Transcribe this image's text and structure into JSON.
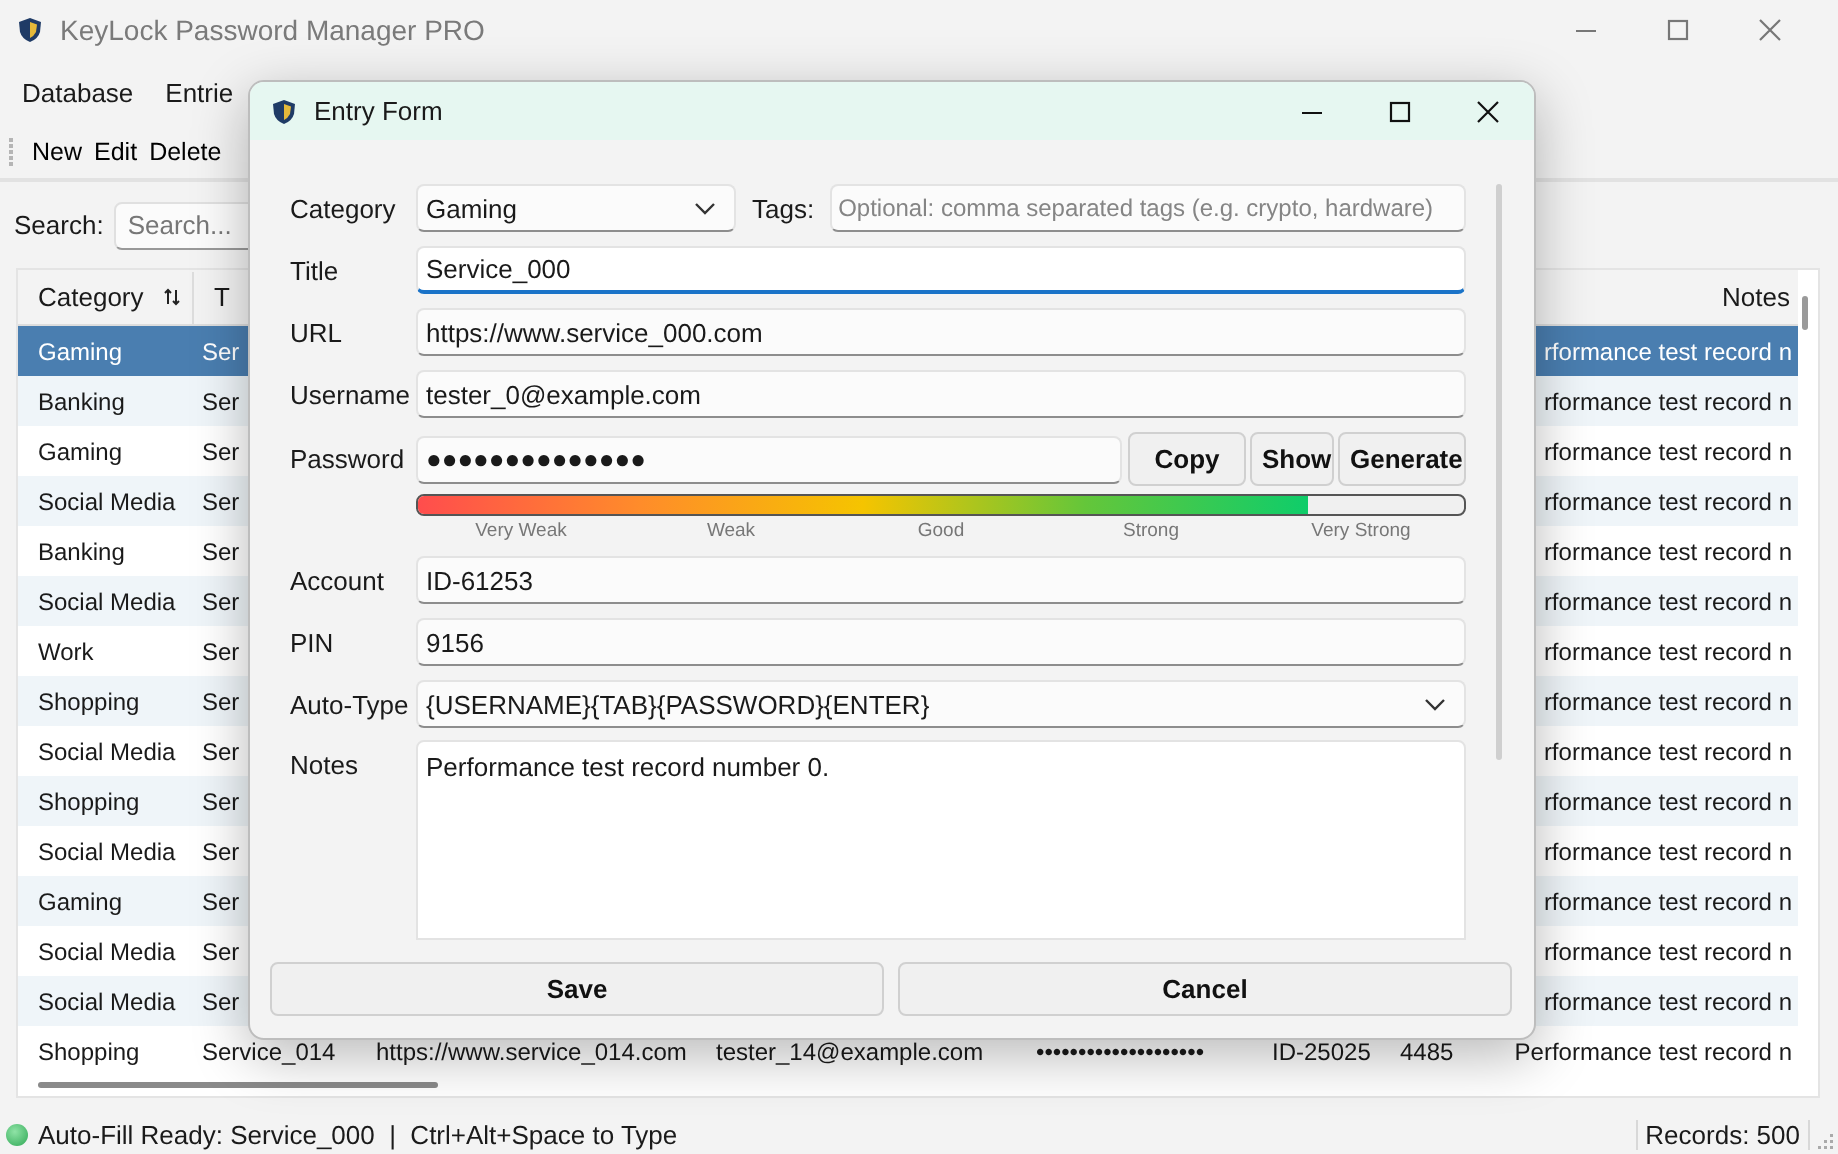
{
  "window": {
    "title": "KeyLock Password Manager PRO"
  },
  "menu": [
    "Database",
    "Entrie"
  ],
  "toolbar": [
    "New",
    "Edit",
    "Delete"
  ],
  "search": {
    "label": "Search:",
    "placeholder": "Search..."
  },
  "table": {
    "columns": [
      {
        "label": "Category",
        "sortable": true
      },
      {
        "label": "T",
        "sortable": false
      },
      {
        "label": "Notes",
        "sortable": false
      }
    ],
    "rows": [
      {
        "category": "Gaming",
        "title": "Ser",
        "notes": "rformance test record n",
        "selected": true
      },
      {
        "category": "Banking",
        "title": "Ser",
        "notes": "rformance test record n",
        "selected": false
      },
      {
        "category": "Gaming",
        "title": "Ser",
        "notes": "rformance test record n",
        "selected": false
      },
      {
        "category": "Social Media",
        "title": "Ser",
        "notes": "rformance test record n",
        "selected": false
      },
      {
        "category": "Banking",
        "title": "Ser",
        "notes": "rformance test record n",
        "selected": false
      },
      {
        "category": "Social Media",
        "title": "Ser",
        "notes": "rformance test record n",
        "selected": false
      },
      {
        "category": "Work",
        "title": "Ser",
        "notes": "rformance test record n",
        "selected": false
      },
      {
        "category": "Shopping",
        "title": "Ser",
        "notes": "rformance test record n",
        "selected": false
      },
      {
        "category": "Social Media",
        "title": "Ser",
        "notes": "rformance test record n",
        "selected": false
      },
      {
        "category": "Shopping",
        "title": "Ser",
        "notes": "rformance test record n",
        "selected": false
      },
      {
        "category": "Social Media",
        "title": "Ser",
        "notes": "rformance test record n",
        "selected": false
      },
      {
        "category": "Gaming",
        "title": "Ser",
        "notes": "rformance test record n",
        "selected": false
      },
      {
        "category": "Social Media",
        "title": "Ser",
        "notes": "rformance test record n",
        "selected": false
      },
      {
        "category": "Social Media",
        "title": "Ser",
        "notes": "rformance test record n",
        "selected": false
      },
      {
        "category": "Shopping",
        "title": "Service_014",
        "url": "https://www.service_014.com",
        "username": "tester_14@example.com",
        "password": "••••••••••••••••••••",
        "account": "ID-25025",
        "pin": "4485",
        "notes": "Performance test record n",
        "selected": false
      }
    ]
  },
  "status_bar": {
    "message": "Auto-Fill Ready: Service_000  |  Ctrl+Alt+Space to Type",
    "records": "Records: 500"
  },
  "dialog": {
    "title": "Entry Form",
    "category": {
      "label": "Category",
      "value": "Gaming"
    },
    "tags": {
      "label": "Tags:",
      "placeholder": "Optional: comma separated tags (e.g. crypto, hardware)"
    },
    "fields": [
      {
        "label": "Title",
        "value": "Service_000",
        "focused": true
      },
      {
        "label": "URL",
        "value": "https://www.service_000.com",
        "focused": false
      },
      {
        "label": "Username",
        "value": "tester_0@example.com",
        "focused": false
      }
    ],
    "password": {
      "label": "Password",
      "value": "●●●●●●●●●●●●●●",
      "buttons": [
        "Copy",
        "Show",
        "Generate"
      ]
    },
    "strength": {
      "level": 0.85,
      "labels": [
        "Very Weak",
        "Weak",
        "Good",
        "Strong",
        "Very Strong"
      ]
    },
    "fields2": [
      {
        "label": "Account",
        "value": "ID-61253",
        "focused": false
      },
      {
        "label": "PIN",
        "value": "9156",
        "focused": false
      }
    ],
    "auto_type": {
      "label": "Auto-Type",
      "value": "{USERNAME}{TAB}{PASSWORD}{ENTER}"
    },
    "notes": {
      "label": "Notes",
      "value": "Performance test record number 0."
    },
    "buttons": [
      "Save",
      "Cancel"
    ]
  }
}
